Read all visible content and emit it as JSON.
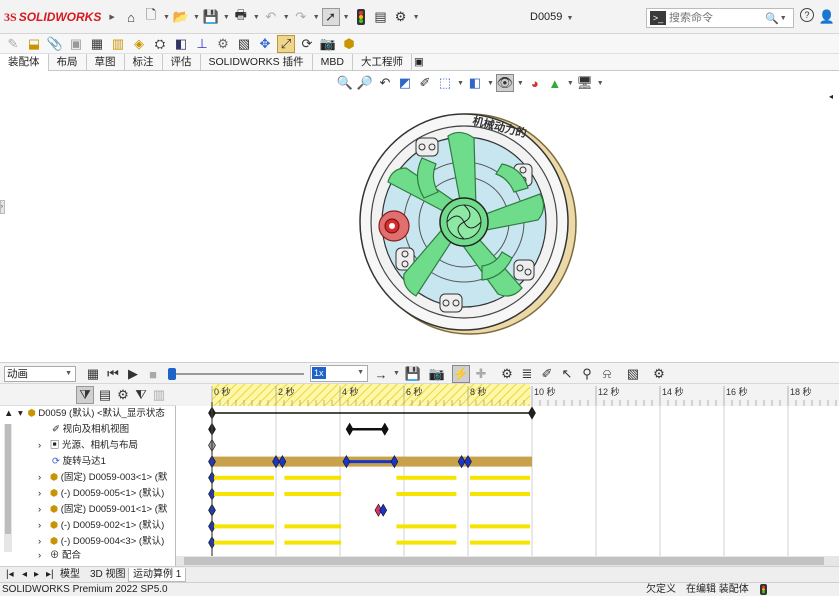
{
  "app": {
    "brand_prefix": "3S",
    "brand_name": "SOLIDWORKS",
    "doc_title": "D0059",
    "search_placeholder": "搜索命令"
  },
  "command_tabs": [
    "装配体",
    "布局",
    "草图",
    "标注",
    "评估",
    "SOLIDWORKS 插件",
    "MBD",
    "大工程师"
  ],
  "model_label": "机械动力的",
  "animation": {
    "mode": "动画",
    "speed": "1x",
    "time_labels": [
      "0 秒",
      "2 秒",
      "4 秒",
      "6 秒",
      "8 秒",
      "10 秒",
      "12 秒",
      "14 秒",
      "16 秒",
      "18 秒"
    ]
  },
  "tree": {
    "root": "D0059 (默认) <默认_显示状态",
    "items": [
      "视向及相机视图",
      "光源、相机与布局",
      "旋转马达1",
      "(固定) D0059-003<1> (默",
      "(-) D0059-005<1> (默认)",
      "(固定) D0059-001<1> (默",
      "(-) D0059-002<1> (默认)",
      "(-) D0059-004<3> (默认)",
      "配合"
    ]
  },
  "bottom_tabs": [
    "模型",
    "3D 视图",
    "运动算例 1"
  ],
  "status": {
    "version": "SOLIDWORKS Premium 2022 SP5.0",
    "defined": "欠定义",
    "editing": "在编辑 装配体"
  },
  "icons": {
    "home": "home-icon",
    "new": "new-document-icon",
    "open": "open-folder-icon",
    "save": "save-icon",
    "print": "print-icon",
    "undo": "undo-icon",
    "redo": "redo-icon",
    "select": "select-arrow-icon",
    "rebuild": "traffic-light-icon",
    "options": "gear-icon",
    "help": "help-icon",
    "user": "user-icon"
  },
  "colors": {
    "brand": "#d71920",
    "key_blue": "#1a35c9",
    "bar_gold": "#c8a24a",
    "bar_yellow": "#f5e400",
    "part_green": "#6fdc8c",
    "part_blue": "#c7e6f0"
  }
}
